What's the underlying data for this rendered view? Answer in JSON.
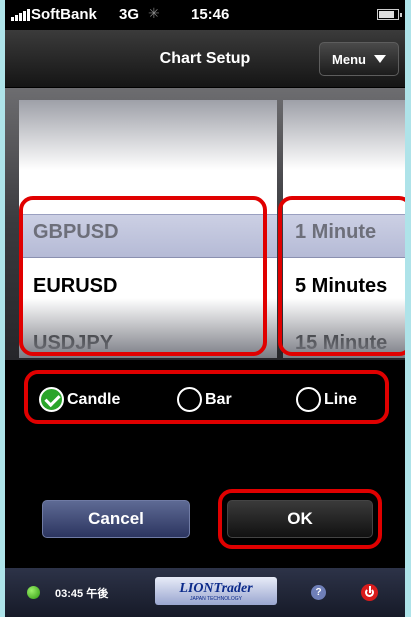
{
  "status_bar": {
    "carrier": "SoftBank",
    "network": "3G",
    "time": "15:46"
  },
  "navbar": {
    "title": "Chart Setup",
    "menu_label": "Menu"
  },
  "picker": {
    "symbols": [
      "GBPUSD",
      "EURUSD",
      "USDJPY"
    ],
    "selected_symbol": "GBPUSD",
    "timeframes": [
      "1 Minute",
      "5 Minutes",
      "15 Minute"
    ],
    "selected_timeframe": "1 Minute"
  },
  "chart_type": {
    "options": [
      "Candle",
      "Bar",
      "Line"
    ],
    "selected": "Candle"
  },
  "buttons": {
    "cancel": "Cancel",
    "ok": "OK"
  },
  "bottom_bar": {
    "clock": "03:45 午後",
    "logo_brand": "LIONTrader",
    "logo_tagline": "JAPAN TECHNOLOGY",
    "help_icon": "?"
  },
  "colors": {
    "highlight": "#e00000",
    "selected_radio": "#2aa52a",
    "cancel_button": "#3d477a"
  }
}
